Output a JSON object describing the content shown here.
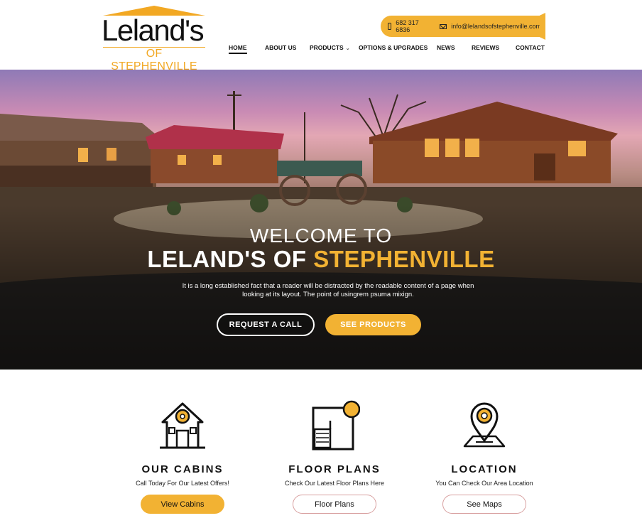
{
  "brand": {
    "name": "Leland's",
    "tagline": "OF STEPHENVILLE"
  },
  "contact": {
    "phone": "682 317 6836",
    "email": "info@lelandsofstephenville.com"
  },
  "nav": {
    "items": [
      {
        "label": "HOME",
        "active": true
      },
      {
        "label": "ABOUT US"
      },
      {
        "label": "PRODUCTS",
        "dropdown": true
      },
      {
        "label": "OPTIONS & UPGRADES"
      },
      {
        "label": "NEWS"
      },
      {
        "label": "REVIEWS"
      },
      {
        "label": "CONTACT"
      }
    ]
  },
  "hero": {
    "title_line1": "WELCOME TO",
    "title_line2_part1": "LELAND'S OF",
    "title_line2_part2": "STEPHENVILLE",
    "text": "It is a long established fact that a reader will be distracted by the readable content of a page when looking at its layout. The point of usingrem psuma mixign.",
    "cta_call": "REQUEST A CALL",
    "cta_products": "SEE PRODUCTS"
  },
  "features": [
    {
      "icon": "house-icon",
      "title": "OUR CABINS",
      "subtitle": "Call Today For Our Latest Offers!",
      "button": "View Cabins"
    },
    {
      "icon": "floor-plan-icon",
      "title": "FLOOR PLANS",
      "subtitle": "Check Our Latest Floor Plans Here",
      "button": "Floor Plans"
    },
    {
      "icon": "map-pin-icon",
      "title": "LOCATION",
      "subtitle": "You Can Check Our Area Location",
      "button": "See Maps"
    }
  ],
  "colors": {
    "accent": "#f2b233",
    "text": "#111111"
  }
}
